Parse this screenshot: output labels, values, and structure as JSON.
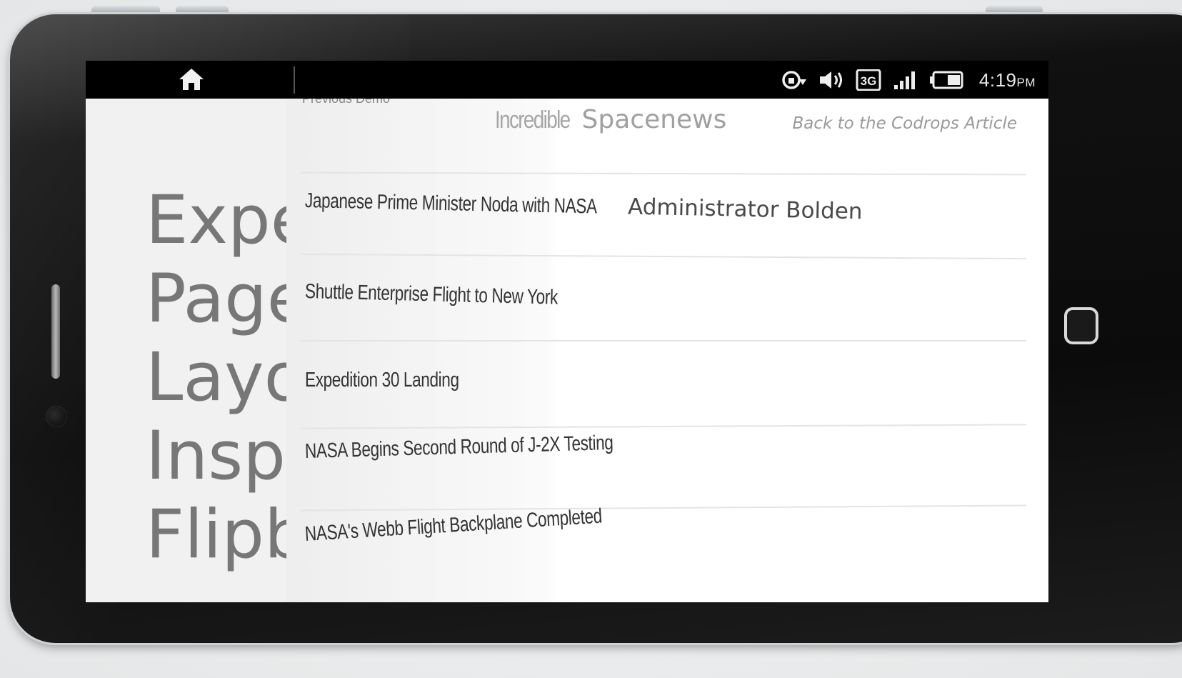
{
  "statusbar": {
    "time": "4:19",
    "ampm": "PM",
    "network": "3G",
    "icons": [
      "home-icon",
      "sync-icon",
      "speaker-icon",
      "network-3g-icon",
      "signal-icon",
      "battery-icon"
    ]
  },
  "left_page": {
    "title_lines": [
      "Expe",
      "Page",
      "Layo",
      "Inspi",
      "Flipb"
    ]
  },
  "right_page": {
    "previous_demo": "Previous Demo",
    "site_title_part1": "Incredible",
    "site_title_part2": "Spacenews",
    "back_link": "Back to the Codrops Article",
    "news": [
      {
        "title": "Japanese Prime Minister Noda with NASA",
        "title_rest": "Administrator Bolden"
      },
      {
        "title": "Shuttle Enterprise Flight to New York",
        "title_rest": ""
      },
      {
        "title": "Expedition 30 Landing",
        "title_rest": ""
      },
      {
        "title": "NASA Begins Second Round of J-2X Testing",
        "title_rest": ""
      },
      {
        "title": "NASA's Webb Flight Backplane Completed",
        "title_rest": ""
      }
    ]
  },
  "colors": {
    "statusbar": "#000000",
    "page_background": "#ffffff",
    "left_page": "#f1f1f1",
    "phone_body": "#111111"
  }
}
